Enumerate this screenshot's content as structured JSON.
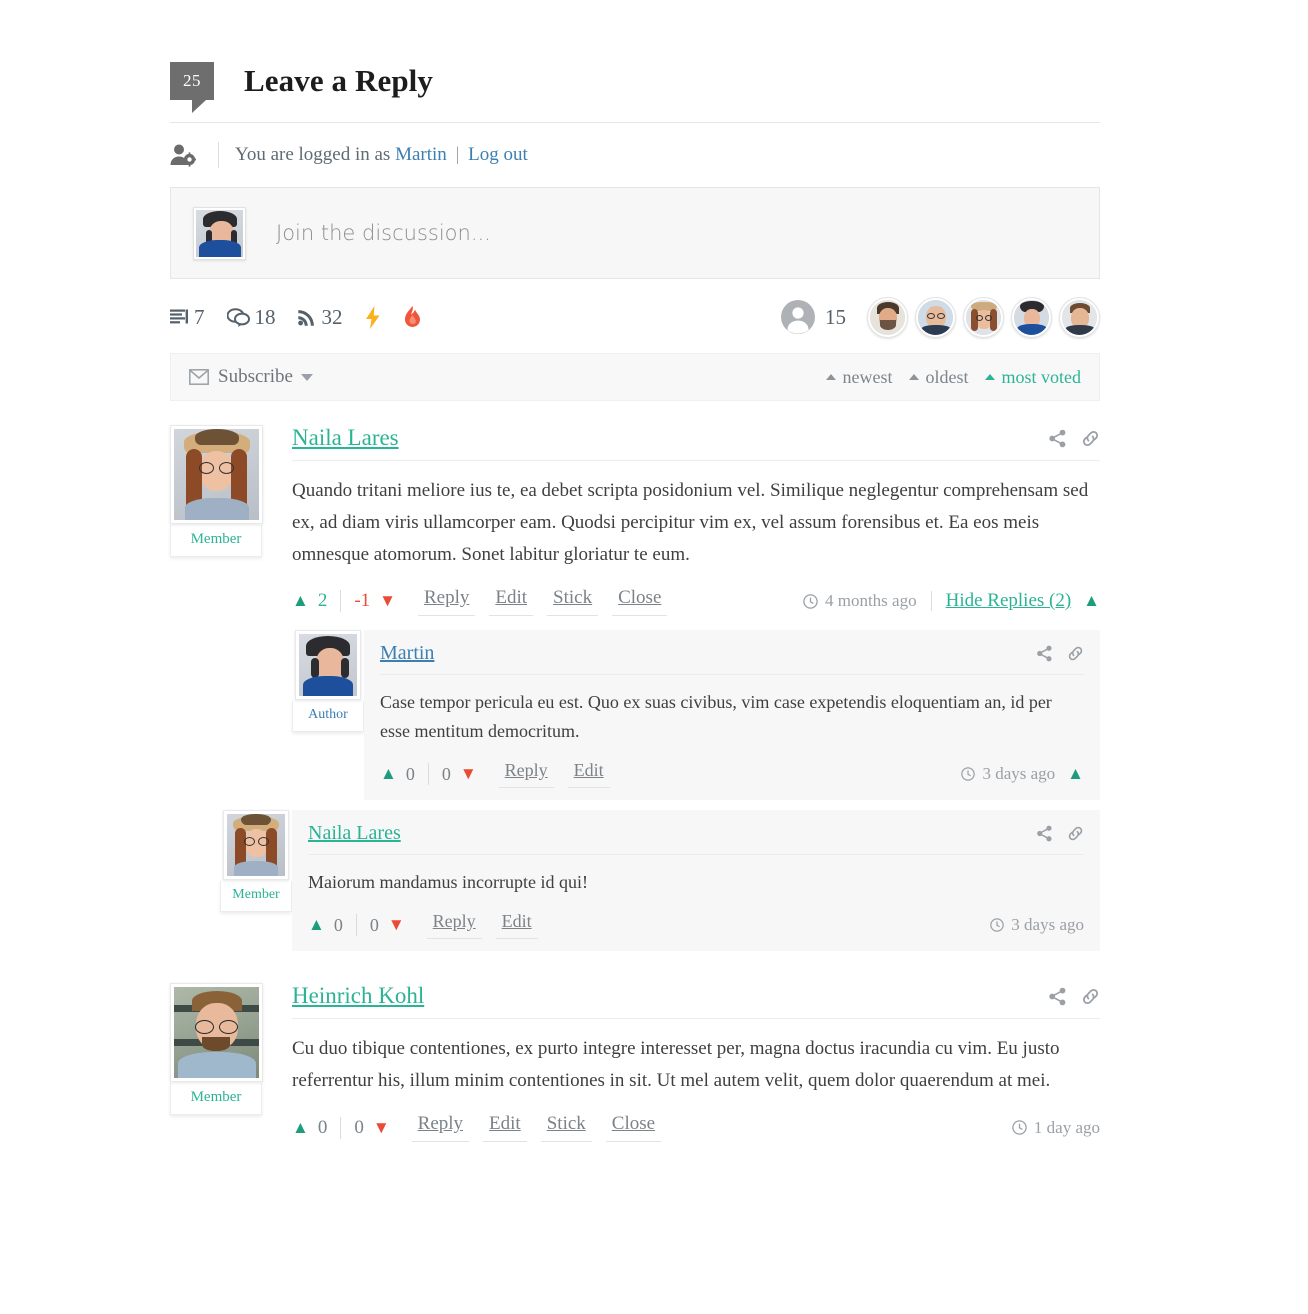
{
  "header": {
    "count_badge": "25",
    "title": "Leave a Reply"
  },
  "login_row": {
    "icon": "user-gear-icon",
    "prefix": "You are logged in as",
    "username": "Martin",
    "separator": "|",
    "logout": "Log out"
  },
  "comment_form": {
    "placeholder": "Join the discussion...",
    "avatar_alt": "Martin avatar"
  },
  "stats": {
    "items": [
      {
        "icon": "threads-icon",
        "value": "7"
      },
      {
        "icon": "comments-icon",
        "value": "18"
      },
      {
        "icon": "rss-icon",
        "value": "32"
      },
      {
        "icon": "bolt-icon",
        "value": ""
      },
      {
        "icon": "flame-icon",
        "value": ""
      }
    ],
    "users_icon": "user-circle-icon",
    "users_count": "15",
    "avatar_count": 5
  },
  "toolbar": {
    "subscribe_icon": "envelope-icon",
    "subscribe_label": "Subscribe",
    "sorts": [
      {
        "label": "newest",
        "active": false
      },
      {
        "label": "oldest",
        "active": false
      },
      {
        "label": "most voted",
        "active": true
      }
    ]
  },
  "colors": {
    "accent_green": "#2bb396",
    "accent_blue": "#3c7fb1",
    "downvote_red": "#ea4b35",
    "badge_gray": "#6e6e6e",
    "bolt_yellow": "#f9b21c",
    "flame_red": "#f0563c"
  },
  "comments": [
    {
      "author": "Naila Lares",
      "role": "Member",
      "role_type": "member",
      "text": "Quando tritani meliore ius te, ea debet scripta posidonium vel. Similique neglegentur comprehensam sed ex, ad diam viris ullamcorper eam. Quodsi percipitur vim ex, vel assum forensibus et. Ea eos meis omnesque atomorum. Sonet labitur gloriatur te eum.",
      "up_value": "2",
      "down_value": "-1",
      "actions": [
        "Reply",
        "Edit",
        "Stick",
        "Close"
      ],
      "time": "4 months ago",
      "hide_replies": "Hide Replies (2)",
      "tools": [
        "share-icon",
        "link-icon"
      ]
    },
    {
      "author": "Martin",
      "role": "Author",
      "role_type": "author",
      "text": "Case tempor pericula eu est. Quo ex suas civibus, vim case expetendis eloquentiam an, id per esse mentitum democritum.",
      "up_value": "0",
      "down_value": "0",
      "actions": [
        "Reply",
        "Edit"
      ],
      "time": "3 days ago",
      "tools": [
        "share-icon",
        "link-icon"
      ]
    },
    {
      "author": "Naila Lares",
      "role": "Member",
      "role_type": "member",
      "text": "Maiorum mandamus incorrupte id qui!",
      "up_value": "0",
      "down_value": "0",
      "actions": [
        "Reply",
        "Edit"
      ],
      "time": "3 days ago",
      "tools": [
        "share-icon",
        "link-icon"
      ]
    },
    {
      "author": "Heinrich Kohl",
      "role": "Member",
      "role_type": "member",
      "text": "Cu duo tibique contentiones, ex purto integre interesset per, magna doctus iracundia cu vim. Eu justo referrentur his, illum minim contentiones in sit. Ut mel autem velit, quem dolor quaerendum at mei.",
      "up_value": "0",
      "down_value": "0",
      "actions": [
        "Reply",
        "Edit",
        "Stick",
        "Close"
      ],
      "time": "1 day ago",
      "tools": [
        "share-icon",
        "link-icon"
      ]
    }
  ]
}
